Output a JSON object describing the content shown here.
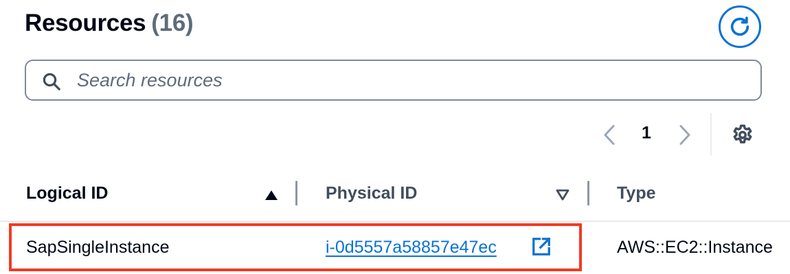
{
  "header": {
    "title": "Resources",
    "count": "(16)"
  },
  "search": {
    "placeholder": "Search resources",
    "value": ""
  },
  "pagination": {
    "current_page": "1"
  },
  "table": {
    "columns": [
      {
        "label": "Logical ID",
        "sort": "ascending"
      },
      {
        "label": "Physical ID",
        "sort": "none"
      },
      {
        "label": "Type"
      }
    ],
    "rows": [
      {
        "logical_id": "SapSingleInstance",
        "physical_id": "i-0d5557a58857e47ec",
        "type": "AWS::EC2::Instance"
      }
    ]
  },
  "colors": {
    "link": "#0972d3",
    "highlight": "#f43a21",
    "text": "#000716",
    "muted": "#5f6b7a"
  },
  "icons": {
    "refresh": "refresh-icon",
    "search": "search-icon",
    "prev": "chevron-left-icon",
    "next": "chevron-right-icon",
    "settings": "gear-icon",
    "sort_asc": "sort-ascending-icon",
    "sort_desc": "sort-descending-icon",
    "external": "external-link-icon"
  }
}
